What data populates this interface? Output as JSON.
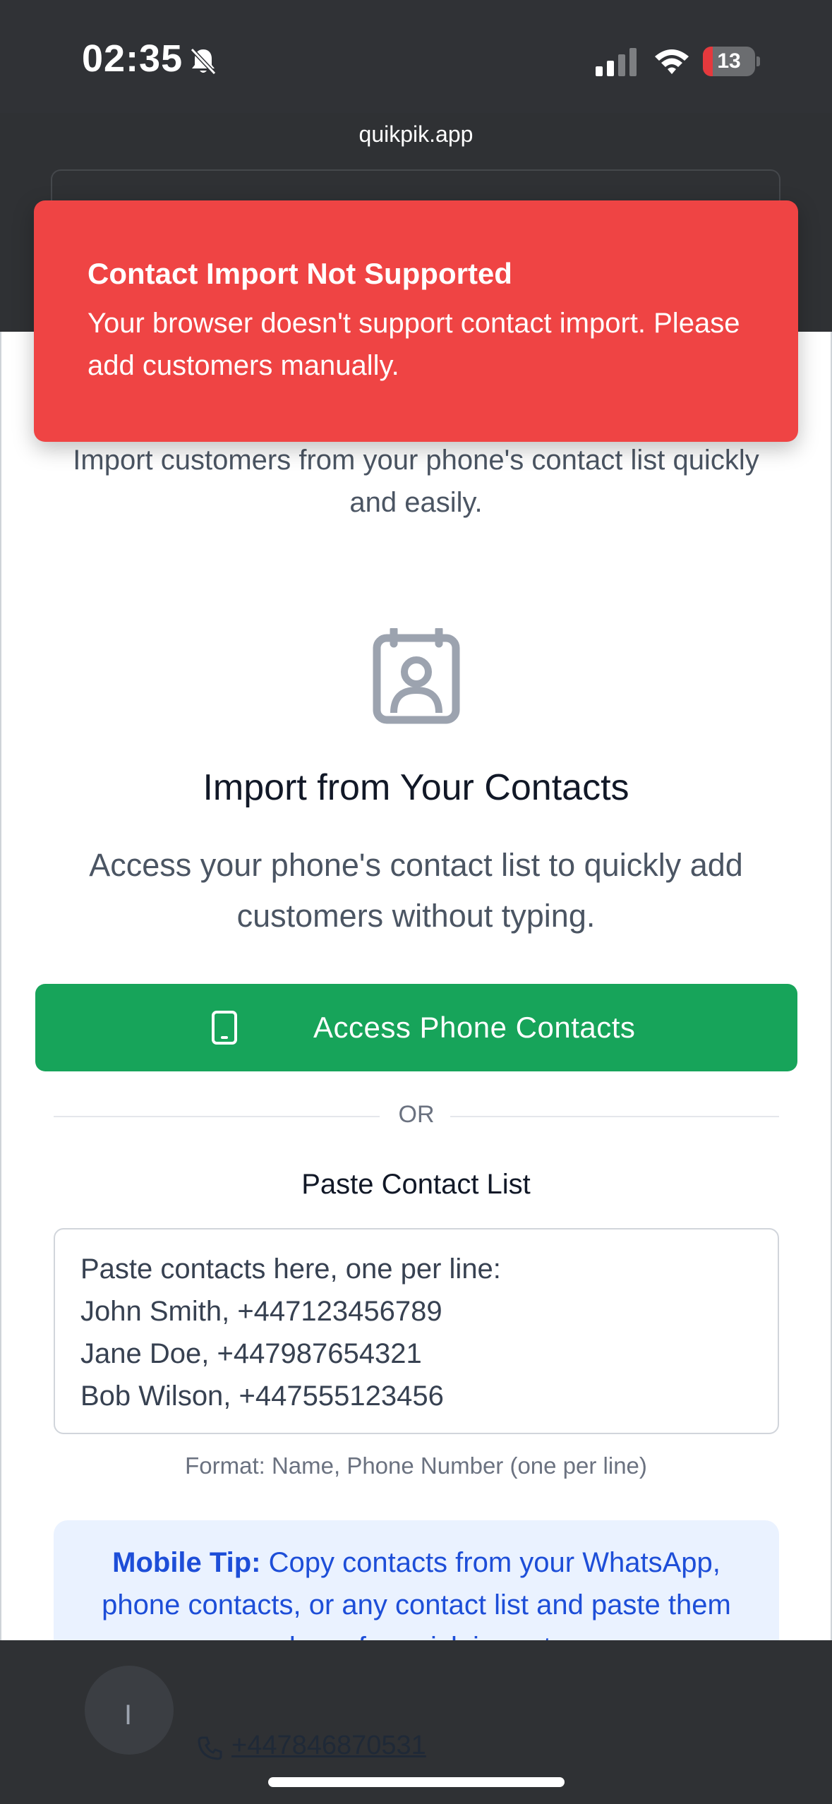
{
  "status_bar": {
    "time": "02:35",
    "battery": "13",
    "icons": [
      "bell-slash-icon",
      "signal-icon",
      "wifi-icon",
      "battery-icon"
    ]
  },
  "browser": {
    "url": "quikpik.app"
  },
  "toast": {
    "title": "Contact Import Not Supported",
    "message": "Your browser doesn't support contact import. Please add customers manually.",
    "color": "#ef4444"
  },
  "import_section": {
    "intro": "Import customers from your phone's contact list quickly and easily.",
    "icon": "contact-book-icon",
    "heading": "Import from Your Contacts",
    "description": "Access your phone's contact list to quickly add customers without typing.",
    "access_button": "Access Phone Contacts",
    "access_button_color": "#17a45a",
    "divider": "OR",
    "paste_title": "Paste Contact List",
    "paste_placeholder": "Paste contacts here, one per line:\nJohn Smith, +447123456789\nJane Doe, +447987654321\nBob Wilson, +447555123456",
    "format_hint": "Format: Name, Phone Number (one per line)"
  },
  "tip": {
    "label": "Mobile Tip:",
    "text": " Copy contacts from your WhatsApp, phone contacts, or any contact list and paste them above for quick import."
  },
  "background_list": {
    "phone": "+447846870531"
  }
}
